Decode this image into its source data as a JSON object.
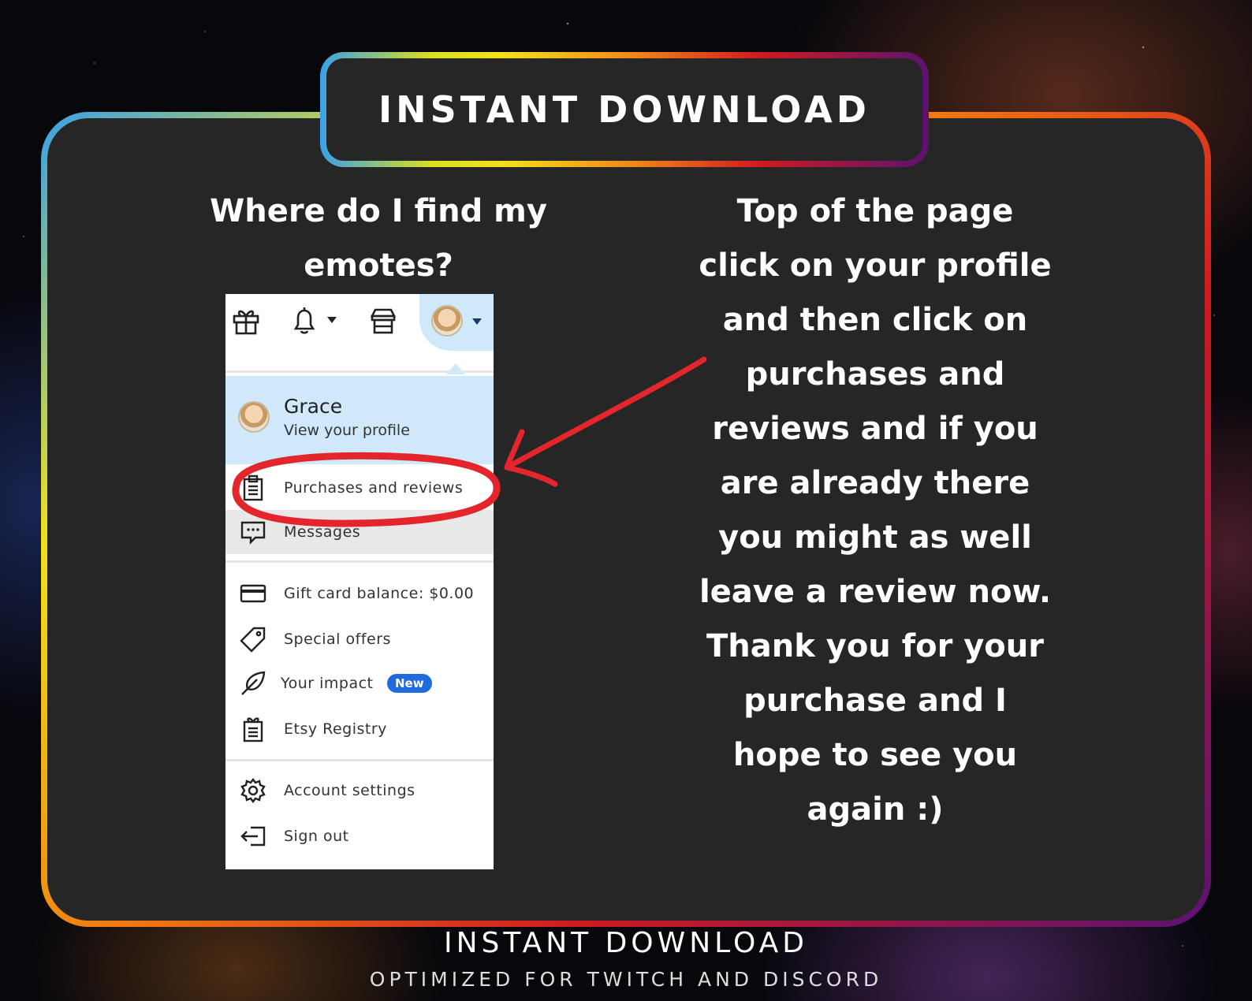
{
  "banner": {
    "title": "INSTANT DOWNLOAD"
  },
  "question": {
    "lines": [
      "Where do I find my",
      "emotes?"
    ]
  },
  "answer": {
    "lines": [
      "Top of the page",
      "click on your profile",
      "and then click on",
      "purchases and",
      "reviews and if you",
      "are already there",
      "you might as well",
      "leave a review now.",
      "Thank you for your",
      "purchase and I",
      "hope to see you",
      "again :)"
    ]
  },
  "screenshot": {
    "profile": {
      "name": "Grace",
      "link": "View your profile"
    },
    "menu": {
      "purchases": "Purchases and reviews",
      "messages": "Messages",
      "gift_card": "Gift card balance: $0.00",
      "offers": "Special offers",
      "impact": "Your impact",
      "impact_badge": "New",
      "registry": "Etsy Registry",
      "settings": "Account settings",
      "signout": "Sign out"
    },
    "icons": {
      "gift": "gift-icon",
      "bell": "bell-icon",
      "shop": "shop-icon",
      "avatar": "avatar"
    },
    "highlight_color": "#e3262b"
  },
  "footer": {
    "title": "INSTANT DOWNLOAD",
    "subtitle": "OPTIMIZED FOR TWITCH AND DISCORD"
  }
}
